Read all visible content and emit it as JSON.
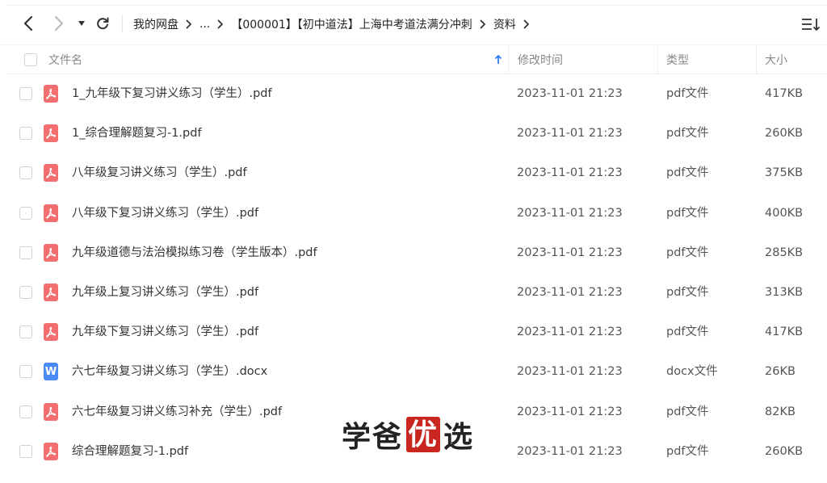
{
  "toolbar": {
    "back_icon": "chevron-left-icon",
    "forward_icon": "chevron-right-icon",
    "history_icon": "caret-down-icon",
    "refresh_icon": "refresh-icon",
    "sort_icon": "sort-lines-icon"
  },
  "breadcrumb": {
    "root": "我的网盘",
    "ellipsis": "...",
    "folder": "【000001】【初中道法】上海中考道法满分冲刺",
    "current": "资料"
  },
  "header": {
    "name": "文件名",
    "modified": "修改时间",
    "type": "类型",
    "size": "大小"
  },
  "colors": {
    "pdf_icon": "#f36f6f",
    "doc_icon": "#4b8bf5",
    "sort_arrow": "#2e7df6",
    "seal": "#c8261e"
  },
  "files": [
    {
      "name": "1_九年级下复习讲义练习（学生）.pdf",
      "modified": "2023-11-01 21:23",
      "type": "pdf文件",
      "size": "417KB",
      "icon": "pdf"
    },
    {
      "name": "1_综合理解题复习-1.pdf",
      "modified": "2023-11-01 21:23",
      "type": "pdf文件",
      "size": "260KB",
      "icon": "pdf"
    },
    {
      "name": "八年级复习讲义练习（学生）.pdf",
      "modified": "2023-11-01 21:23",
      "type": "pdf文件",
      "size": "375KB",
      "icon": "pdf"
    },
    {
      "name": "八年级下复习讲义练习（学生）.pdf",
      "modified": "2023-11-01 21:23",
      "type": "pdf文件",
      "size": "400KB",
      "icon": "pdf"
    },
    {
      "name": "九年级道德与法治模拟练习卷（学生版本）.pdf",
      "modified": "2023-11-01 21:23",
      "type": "pdf文件",
      "size": "285KB",
      "icon": "pdf"
    },
    {
      "name": "九年级上复习讲义练习（学生）.pdf",
      "modified": "2023-11-01 21:23",
      "type": "pdf文件",
      "size": "313KB",
      "icon": "pdf"
    },
    {
      "name": "九年级下复习讲义练习（学生）.pdf",
      "modified": "2023-11-01 21:23",
      "type": "pdf文件",
      "size": "417KB",
      "icon": "pdf"
    },
    {
      "name": "六七年级复习讲义练习（学生）.docx",
      "modified": "2023-11-01 21:23",
      "type": "docx文件",
      "size": "26KB",
      "icon": "docx",
      "icon_letter": "W"
    },
    {
      "name": "六七年级复习讲义练习补充（学生）.pdf",
      "modified": "2023-11-01 21:23",
      "type": "pdf文件",
      "size": "82KB",
      "icon": "pdf"
    },
    {
      "name": "综合理解题复习-1.pdf",
      "modified": "2023-11-01 21:23",
      "type": "pdf文件",
      "size": "260KB",
      "icon": "pdf"
    }
  ],
  "watermark": {
    "part1": "学爸",
    "seal": "优",
    "part2": "选"
  }
}
